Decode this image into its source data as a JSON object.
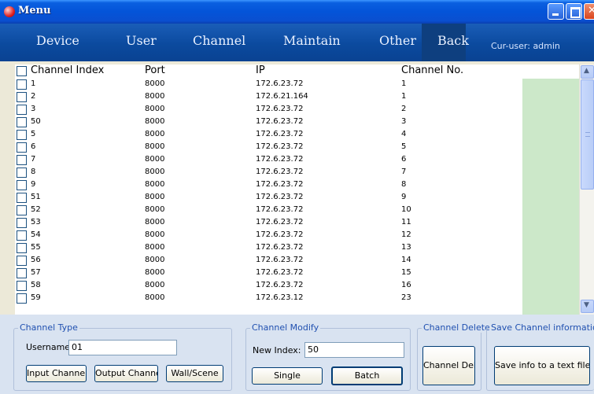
{
  "window": {
    "title": "Menu"
  },
  "menu": {
    "items": [
      "Device",
      "User",
      "Channel",
      "Maintain",
      "Other",
      "Back"
    ],
    "cur_user": "Cur-user: admin"
  },
  "table": {
    "columns": [
      "Channel Index",
      "Port",
      "IP",
      "Channel No."
    ],
    "rows": [
      [
        "1",
        "8000",
        "172.6.23.72",
        "1"
      ],
      [
        "2",
        "8000",
        "172.6.21.164",
        "1"
      ],
      [
        "3",
        "8000",
        "172.6.23.72",
        "2"
      ],
      [
        "50",
        "8000",
        "172.6.23.72",
        "3"
      ],
      [
        "5",
        "8000",
        "172.6.23.72",
        "4"
      ],
      [
        "6",
        "8000",
        "172.6.23.72",
        "5"
      ],
      [
        "7",
        "8000",
        "172.6.23.72",
        "6"
      ],
      [
        "8",
        "8000",
        "172.6.23.72",
        "7"
      ],
      [
        "9",
        "8000",
        "172.6.23.72",
        "8"
      ],
      [
        "51",
        "8000",
        "172.6.23.72",
        "9"
      ],
      [
        "52",
        "8000",
        "172.6.23.72",
        "10"
      ],
      [
        "53",
        "8000",
        "172.6.23.72",
        "11"
      ],
      [
        "54",
        "8000",
        "172.6.23.72",
        "12"
      ],
      [
        "55",
        "8000",
        "172.6.23.72",
        "13"
      ],
      [
        "56",
        "8000",
        "172.6.23.72",
        "14"
      ],
      [
        "57",
        "8000",
        "172.6.23.72",
        "15"
      ],
      [
        "58",
        "8000",
        "172.6.23.72",
        "16"
      ],
      [
        "59",
        "8000",
        "172.6.23.12",
        "23"
      ]
    ]
  },
  "channel_type": {
    "title": "Channel Type",
    "username_label": "Username:",
    "username_value": "01",
    "buttons": [
      "Input Channel",
      "Output Channe",
      "Wall/Scene"
    ]
  },
  "channel_modify": {
    "title": "Channel Modify",
    "index_label": "New Index:",
    "index_value": "50",
    "single_label": "Single",
    "batch_label": "Batch"
  },
  "channel_delete": {
    "title": "Channel Delete",
    "button_label": "Channel Delete"
  },
  "save_info": {
    "title": "Save Channel information",
    "button_label": "Save info to a text file"
  },
  "colors": {
    "title_bar": "#0454d8",
    "menu_bar": "#0b4a9e",
    "green_column": "#cce8c9",
    "bottom_panel": "#d9e3f1"
  }
}
